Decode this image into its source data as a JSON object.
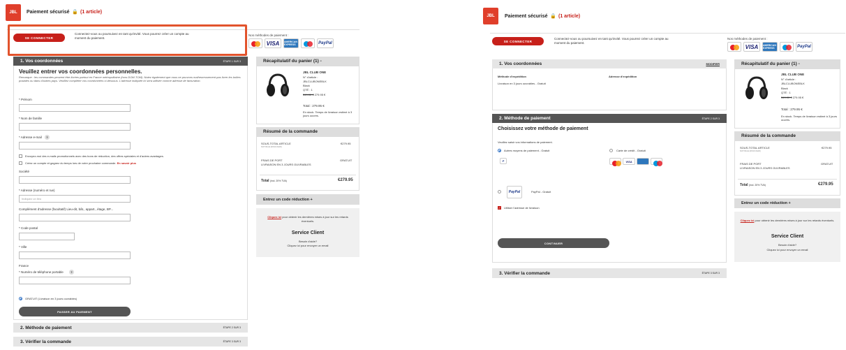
{
  "header": {
    "logo_text": "JBL",
    "logo_sub": "by HARMAN",
    "title": "Paiement sécurisé",
    "lock": "🔒",
    "article_count": "(1 article)"
  },
  "login": {
    "button": "SE CONNECTER",
    "text": "Connectez-vous ou poursuivez en tant qu'invité. Vous pourrez créer un compte au moment du paiement."
  },
  "payment_methods_label": "Nos méthodes de paiement :",
  "cards": {
    "visa": "VISA",
    "amex": "AMERICAN EXPRESS",
    "paypal": "PayPal"
  },
  "left": {
    "step1": {
      "title": "1. Vos coordonnées",
      "note": "ÉTAPE 1 SUR 3"
    },
    "form": {
      "heading": "Veuillez entrer vos coordonnées personnelles.",
      "remark": "Remarque : les commandes peuvent être livrées partout en France métropolitaine (hors DOM-TOM). Notez également que nous ne pouvons malheureusement pas livrer les boîtes postales ou dans d'autres pays. Veuillez compléter vos coordonnées ci-dessous. L'adresse indiquée ici sera utilisée comme adresse de facturation.",
      "prenom": "* Prénom",
      "nom": "* Nom de famille",
      "email": "* Adresse e-mail",
      "help": "?",
      "newsletter": "Envoyez-moi des e-mails promotionnels avec des bons de réduction, des offres spéciales et d'autres avantages.",
      "create_account": "Créez un compte et gagnez du temps lors de votre prochaine commande.",
      "learn_more": "En savoir plus",
      "societe": "Société",
      "adresse": "* Adresse (numéro et rue)",
      "adresse_placeholder": "Indiquez un lieu",
      "complement": "Complément d'adresse (facultatif) Lieu-dit, bât., appart., étage, BP...",
      "code_postal": "* Code postal",
      "ville": "* Ville",
      "pays": "France",
      "telephone": "* Numéro de téléphone portable",
      "shipping_option": "GRATUIT (Livraison en 3 jours ouvrables)",
      "submit": "PASSER AU PAIEMENT"
    },
    "step2": {
      "title": "2. Méthode de paiement",
      "note": "ÉTAPE 2 SUR 3"
    },
    "step3": {
      "title": "3. Vérifier la commande",
      "note": "ÉTAPE 3 SUR 3"
    }
  },
  "right": {
    "step1": {
      "title": "1. Vos coordonnées",
      "edit": "MODIFIER"
    },
    "shipping_method_label": "Méthode d'expédition",
    "shipping_address_label": "Adresse d'expédition",
    "shipping_method_value": "Livraison en 3 jours ouvrables - Gratuit",
    "step2": {
      "title": "2. Méthode de paiement",
      "note": "ÉTAPE 2 SUR 3"
    },
    "choose_title": "Choisissez votre méthode de paiement",
    "choose_sub": "Veuillez saisir vos informations de paiement.",
    "other_methods": "Autres moyens de paiement - Gratuit",
    "credit_card": "Carte de crédit - Gratuit",
    "paypal_label": "PayPal - Gratuit",
    "use_shipping": "Utiliser l'adresse de livraison",
    "continue": "CONTINUER",
    "step3": {
      "title": "3. Vérifier la commande",
      "note": "ÉTAPE 3 SUR 3"
    }
  },
  "cart": {
    "title": "Récapitulatif du panier (1) -",
    "product_name": "JBL CLUB ONE",
    "article_no": "N° d'article :",
    "sku": "JBLCLUBONEBLK",
    "color": "Black",
    "qty": "QTÉ : 1",
    "old_price": "349.00 €",
    "new_price": "279.95 €",
    "total_line": "Total : 279.95 €",
    "stock": "En stock. Temps de livraison estimé à 3 jours ouvrés."
  },
  "summary": {
    "title": "Résumé de la commande",
    "subtotal_label": "SOUS-TOTAL ARTICLE",
    "subtotal_sub": "SOIT BLUE (DISCO-MAR)",
    "subtotal_value": "€279.95",
    "shipping_label": "FRAIS DE PORT",
    "shipping_sub": "LIVRAISON EN 3 JOURS OUVRABLES",
    "shipping_value": "GRATUIT",
    "total_label": "Total",
    "total_tax": "(incl. 20% TVA)",
    "total_value": "€279.95"
  },
  "promo": {
    "title": "Entrez un code réduction +"
  },
  "service": {
    "click_here": "Cliquez ici",
    "info_text": "pour obtenir les dernières mises à jour sur les retards éventuels.",
    "title": "Service Client",
    "help_q": "Besoin d'aide?",
    "contact": "Cliquez ici pour envoyer un email"
  }
}
